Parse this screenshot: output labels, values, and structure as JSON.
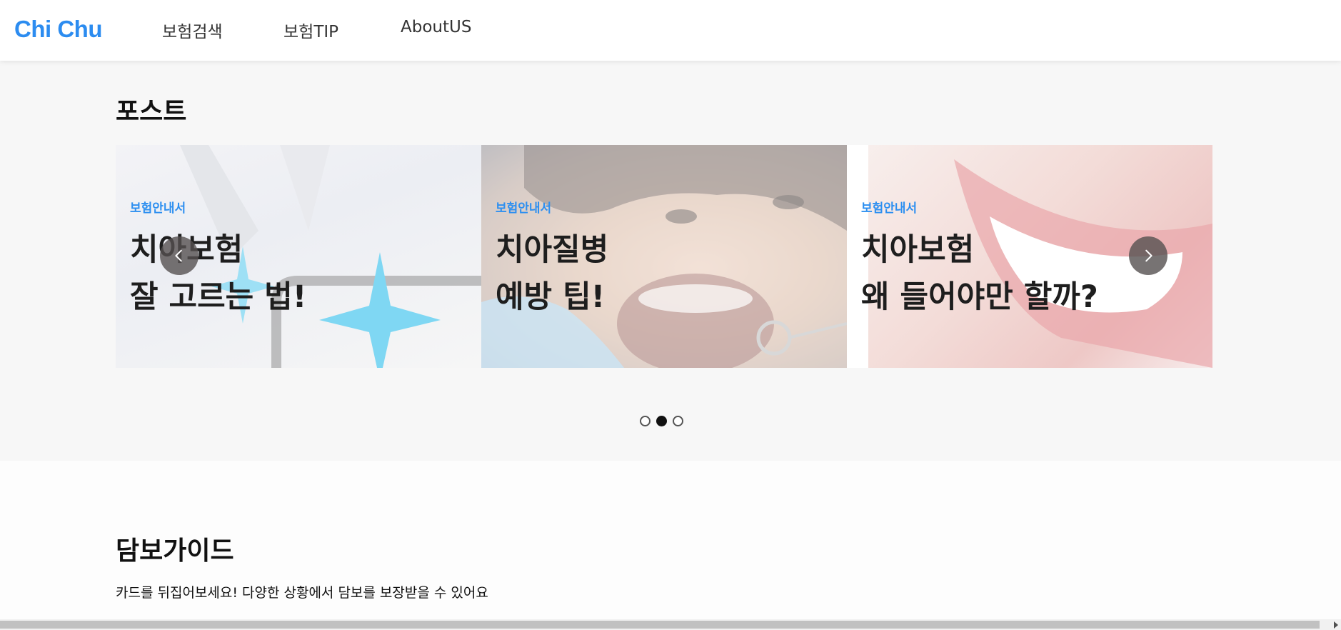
{
  "header": {
    "logo": "Chi Chu",
    "nav": [
      "보험검색",
      "보험TIP",
      "AboutUS"
    ]
  },
  "post_section": {
    "title": "포스트",
    "slides": [
      {
        "tag": "보험안내서",
        "line1": "치아보험",
        "line2": "잘 고르는 법!"
      },
      {
        "tag": "보험안내서",
        "line1": "치아질병",
        "line2": "예방 팁!"
      },
      {
        "tag": "보험안내서",
        "line1": "치아보험",
        "line2": "왜 들어야만 할까?"
      }
    ],
    "active_dot": 2,
    "dot_count": 3
  },
  "guide_section": {
    "title": "담보가이드",
    "subtitle": "카드를 뒤집어보세요! 다양한 상황에서 담보를 보장받을 수 있어요"
  },
  "colors": {
    "brand": "#2c8cf0",
    "tag": "#2d8ff0",
    "section_bg": "#f7f7f7"
  },
  "icons": {
    "prev": "chevron-left-icon",
    "next": "chevron-right-icon"
  }
}
